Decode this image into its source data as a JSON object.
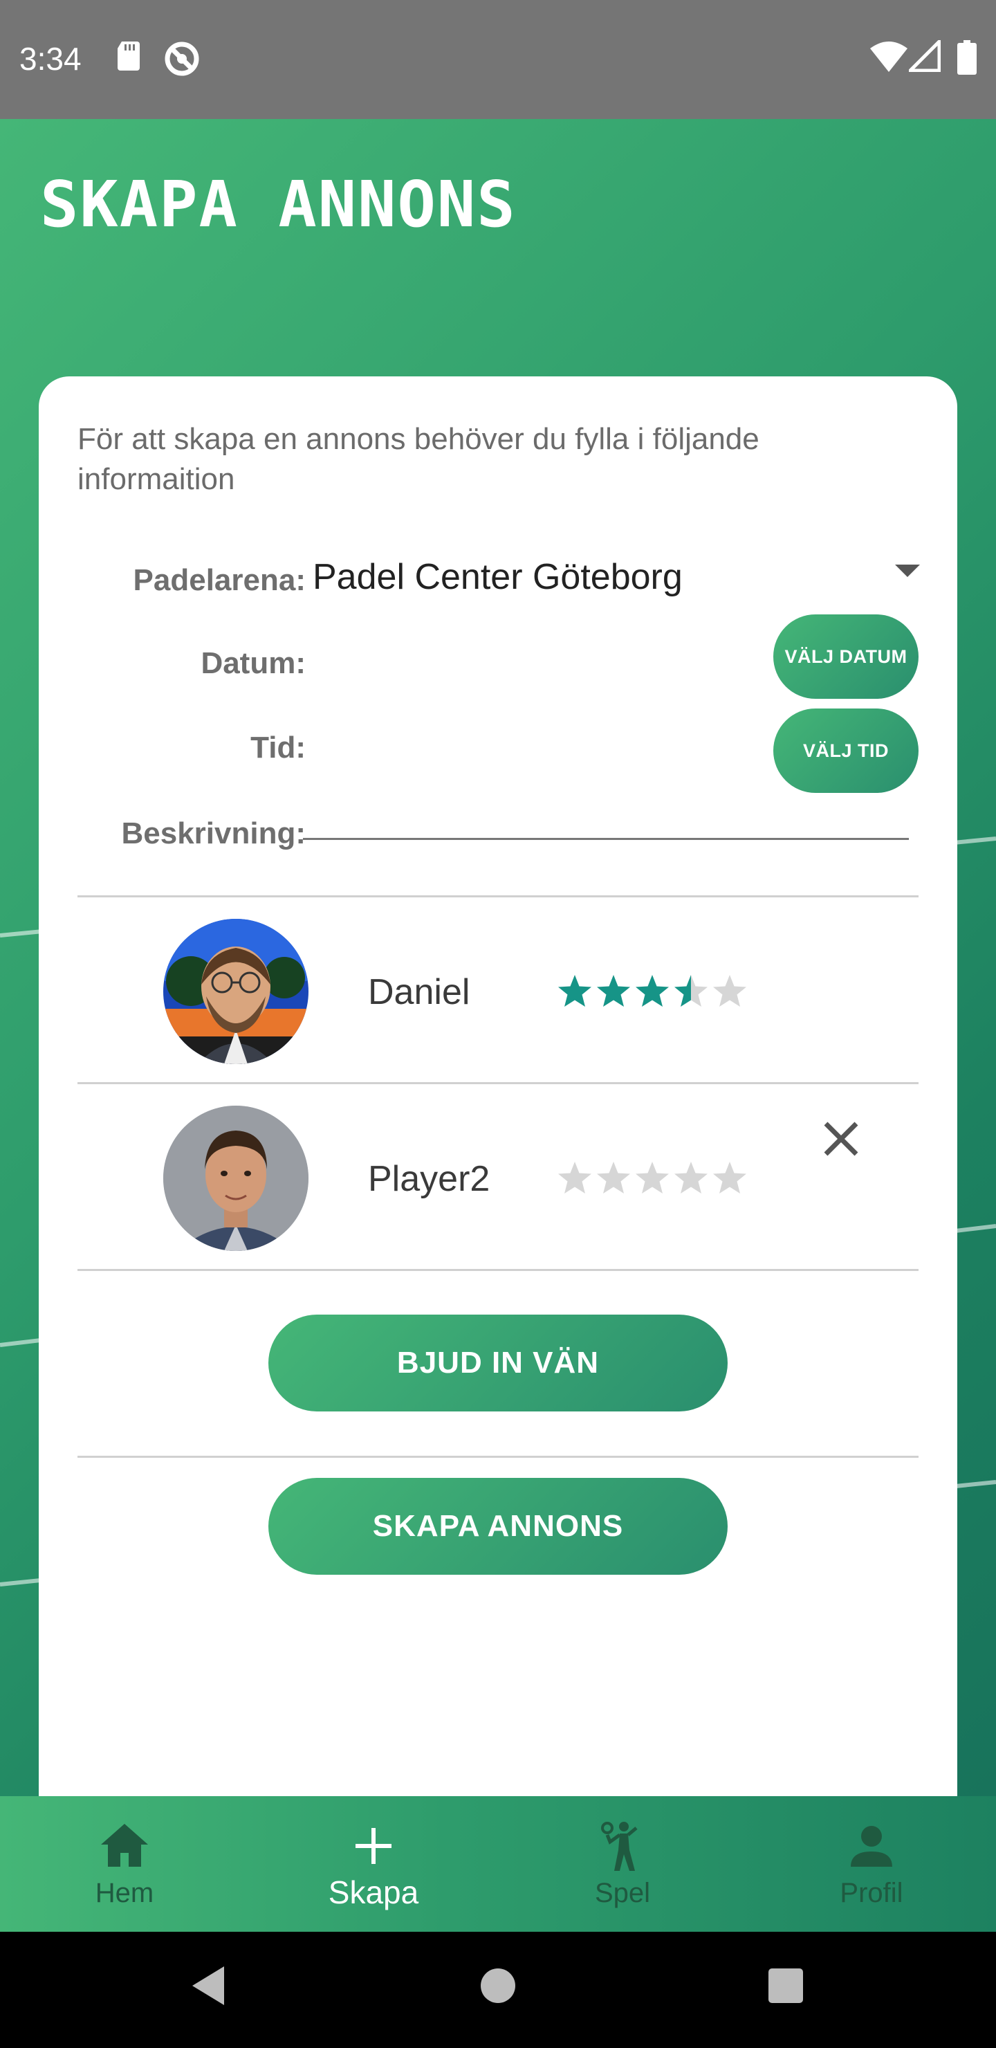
{
  "status_bar": {
    "time": "3:34",
    "icons": [
      "sd-card-icon",
      "no-disturb-icon",
      "wifi-icon",
      "signal-icon",
      "battery-icon"
    ]
  },
  "header": {
    "title": "SKAPA ANNONS"
  },
  "form": {
    "intro": "För att skapa en annons behöver du fylla i följande informaition",
    "arena_label": "Padelarena:",
    "arena_value": "Padel Center Göteborg",
    "date_label": "Datum:",
    "date_button": "VÄLJ DATUM",
    "time_label": "Tid:",
    "time_button": "VÄLJ TID",
    "description_label": "Beskrivning:",
    "description_value": ""
  },
  "players": [
    {
      "name": "Daniel",
      "rating": 3.5,
      "max_rating": 5,
      "removable": false
    },
    {
      "name": "Player2",
      "rating": 0,
      "max_rating": 5,
      "removable": true
    }
  ],
  "actions": {
    "invite_button": "BJUD IN VÄN",
    "create_button": "SKAPA ANNONS"
  },
  "bottom_nav": {
    "items": [
      {
        "label": "Hem",
        "icon": "home-icon",
        "active": false
      },
      {
        "label": "Skapa",
        "icon": "plus-icon",
        "active": true
      },
      {
        "label": "Spel",
        "icon": "tennis-player-icon",
        "active": false
      },
      {
        "label": "Profil",
        "icon": "person-icon",
        "active": false
      }
    ]
  },
  "colors": {
    "accent": "#3aa870",
    "star_filled": "#169487",
    "star_empty": "#d6d6d6",
    "nav_inactive": "#1f5a40",
    "status_bar": "#757575"
  }
}
